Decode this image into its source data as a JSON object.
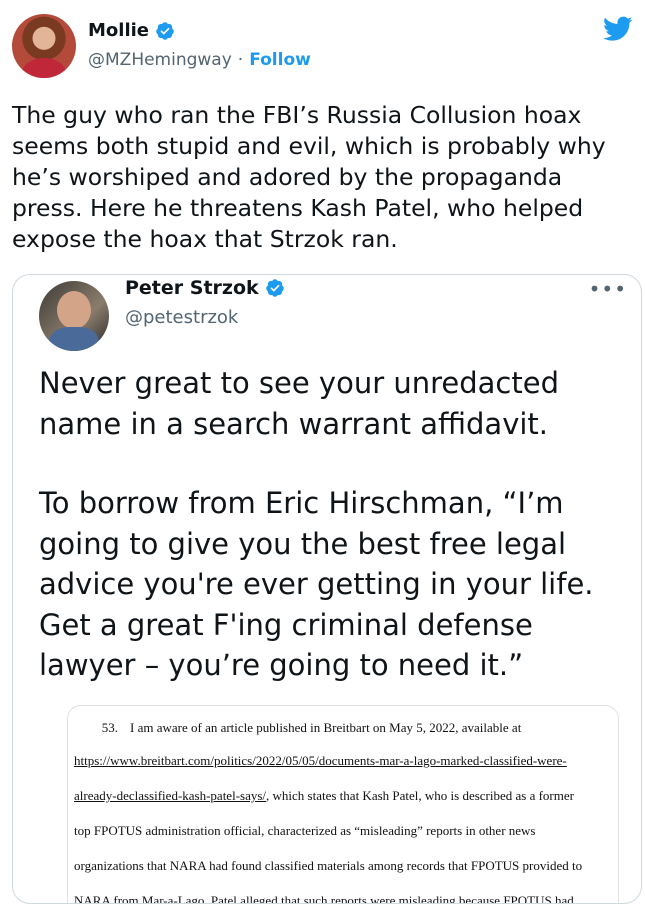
{
  "author": {
    "name": "Mollie",
    "handle": "@MZHemingway",
    "separator": "·",
    "follow_label": "Follow",
    "verified": true
  },
  "tweet_text": "The guy who ran the FBI’s Russia Collusion hoax seems both stupid and evil, which is probably why he’s worshiped and adored by the propaganda press. Here he threatens Kash Patel, who helped expose the hoax that Strzok ran.",
  "quoted": {
    "name": "Peter Strzok",
    "handle": "@petestrzok",
    "more_label": "•••",
    "paragraph_1": "Never great to see your unredacted name in a search warrant affidavit.",
    "paragraph_2": "To borrow from Eric Hirschman, “I’m going to give you the best free legal advice you're ever getting in your life. Get a great F'ing criminal defense lawyer – you’re going to need it.”",
    "document": {
      "paragraph_number": "53.",
      "line_1": "I am aware of an article published in Breitbart on May 5, 2022, available at",
      "line_2_link": "https://www.breitbart.com/politics/2022/05/05/documents-mar-a-lago-marked-classified-were-",
      "line_3_link": "already-declassified-kash-patel-says/",
      "line_3_rest": ", which states that Kash Patel, who is described as a former",
      "line_4": "top FPOTUS administration official, characterized as “misleading” reports in other news",
      "line_5": "organizations that NARA had found classified materials among records that FPOTUS provided to",
      "line_6": "NARA from Mar-a-Lago.  Patel alleged that such reports were misleading because FPOTUS had"
    }
  },
  "colors": {
    "accent": "#1d9bf0",
    "text": "#0f1419",
    "secondary": "#536471",
    "border": "#cfd9de"
  },
  "icons": {
    "verified": "verified-badge-icon",
    "logo": "twitter-bird-icon",
    "more": "more-options-icon"
  }
}
